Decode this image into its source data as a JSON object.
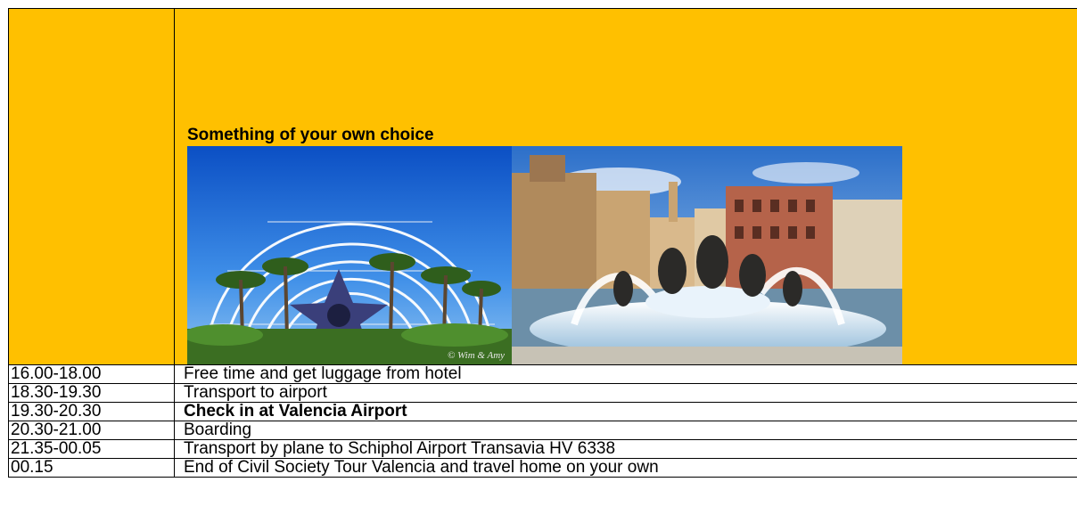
{
  "header": {
    "choice_title": "Something of your own choice",
    "photos": [
      {
        "name": "city-of-arts-sciences-photo",
        "watermark": "© Wim & Amy"
      },
      {
        "name": "plaza-fountain-photo"
      }
    ]
  },
  "schedule": [
    {
      "time": "16.00-18.00",
      "activity": "Free time and get luggage from hotel",
      "bold": false
    },
    {
      "time": "18.30-19.30",
      "activity": "Transport to airport",
      "bold": false
    },
    {
      "time": "19.30-20.30",
      "activity": "Check in at Valencia Airport",
      "bold": true
    },
    {
      "time": "20.30-21.00",
      "activity": "Boarding",
      "bold": false
    },
    {
      "time": "21.35-00.05",
      "activity": "Transport by plane to Schiphol Airport Transavia HV 6338",
      "bold": false
    },
    {
      "time": "00.15",
      "activity": "End of Civil Society Tour Valencia and travel home on your own",
      "bold": false
    }
  ],
  "colors": {
    "header_bg": "#ffc000",
    "border": "#000000"
  }
}
